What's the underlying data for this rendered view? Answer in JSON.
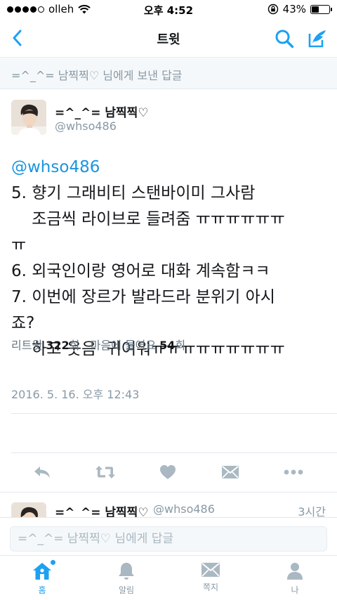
{
  "status_bar": {
    "carrier": "olleh",
    "time": "오후 4:52",
    "battery_percent": "43%",
    "battery_level": 0.43,
    "signal_bars_filled": 4,
    "signal_bars_total": 5
  },
  "nav": {
    "title": "트윗",
    "icons": [
      "chevron-left-icon",
      "search-icon",
      "compose-icon"
    ]
  },
  "reply_context": {
    "text": "=^_^= 남찍찍♡ 님에게 보낸 답글"
  },
  "tweet": {
    "author_name": "=^_^= 남찍찍♡",
    "author_handle": "@whso486",
    "lines": [
      "@whso486",
      "5. 향기 그래비티 스탠바이미 그사람",
      "    조금씩 라이브로 들려줌 ㅠㅠㅠㅠㅠㅠ",
      "ㅠ",
      "6. 외국인이랑 영어로 대화 계속함ㅋㅋ",
      "7. 이번에 장르가 발라드라 분위기 아시",
      "죠?",
      "    하고 웃음  귀여워ㅠㅠㅠㅠㅠㅠㅠㅠㅠ"
    ],
    "timestamp": "2016. 5. 16. 오후 12:43",
    "stats": {
      "retweet_label": "리트윗",
      "retweet_count": "322",
      "retweet_unit": "회",
      "like_label": "마음에 들어요",
      "like_count": "54",
      "like_unit": "회"
    },
    "actions": [
      "reply-icon",
      "retweet-icon",
      "heart-icon",
      "dm-icon",
      "more-icon"
    ]
  },
  "preview": {
    "author_name": "=^_^= 남찍찍♡",
    "author_handle": "@whso486",
    "time": "3시간"
  },
  "reply_box": {
    "placeholder": "=^_^= 남찍찍♡ 님에게 답글"
  },
  "tabbar": {
    "tabs": [
      {
        "label": "홈",
        "icon": "home-icon",
        "active": true
      },
      {
        "label": "알림",
        "icon": "bell-icon",
        "active": false
      },
      {
        "label": "쪽지",
        "icon": "envelope-icon",
        "active": false
      },
      {
        "label": "나",
        "icon": "person-icon",
        "active": false
      }
    ]
  },
  "colors": {
    "accent": "#1da1f2",
    "mention": "#1b95e0",
    "muted": "#8899a6",
    "action_gray": "#aab8c2"
  }
}
